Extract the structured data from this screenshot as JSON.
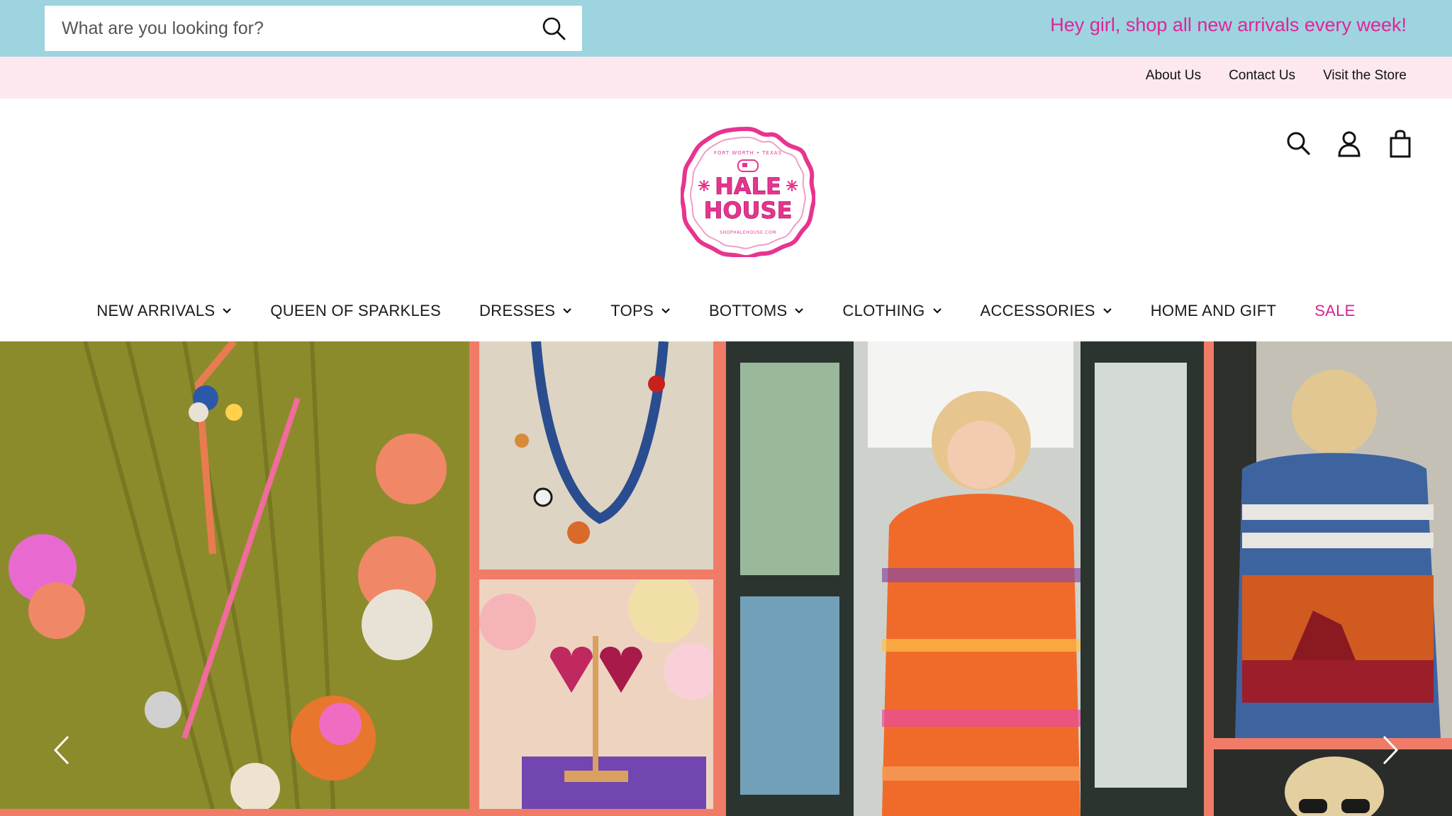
{
  "topbar": {
    "search_placeholder": "What are you looking for?",
    "announcement": "Hey girl, shop all new arrivals every week!"
  },
  "utility_links": [
    "About Us",
    "Contact Us",
    "Visit the Store"
  ],
  "logo": {
    "name_line1": "HALE",
    "name_line2": "HOUSE",
    "arc_top": "FORT WORTH • TEXAS",
    "arc_bottom": "SHOPHALEHOUSE.COM"
  },
  "header_icons": [
    "search-icon",
    "account-icon",
    "cart-icon"
  ],
  "nav": [
    {
      "label": "NEW ARRIVALS",
      "dropdown": true
    },
    {
      "label": "QUEEN OF SPARKLES",
      "dropdown": false
    },
    {
      "label": "DRESSES",
      "dropdown": true
    },
    {
      "label": "TOPS",
      "dropdown": true
    },
    {
      "label": "BOTTOMS",
      "dropdown": true
    },
    {
      "label": "CLOTHING",
      "dropdown": true
    },
    {
      "label": "ACCESSORIES",
      "dropdown": true
    },
    {
      "label": "HOME AND GIFT",
      "dropdown": false
    },
    {
      "label": "SALE",
      "dropdown": false
    }
  ],
  "colors": {
    "topbar_bg": "#9dd4e0",
    "announcement": "#e0249a",
    "utilbar_bg": "#fce8ee",
    "sale": "#d4248c",
    "hero_border": "#f07c68",
    "logo_pink": "#e8348f"
  }
}
